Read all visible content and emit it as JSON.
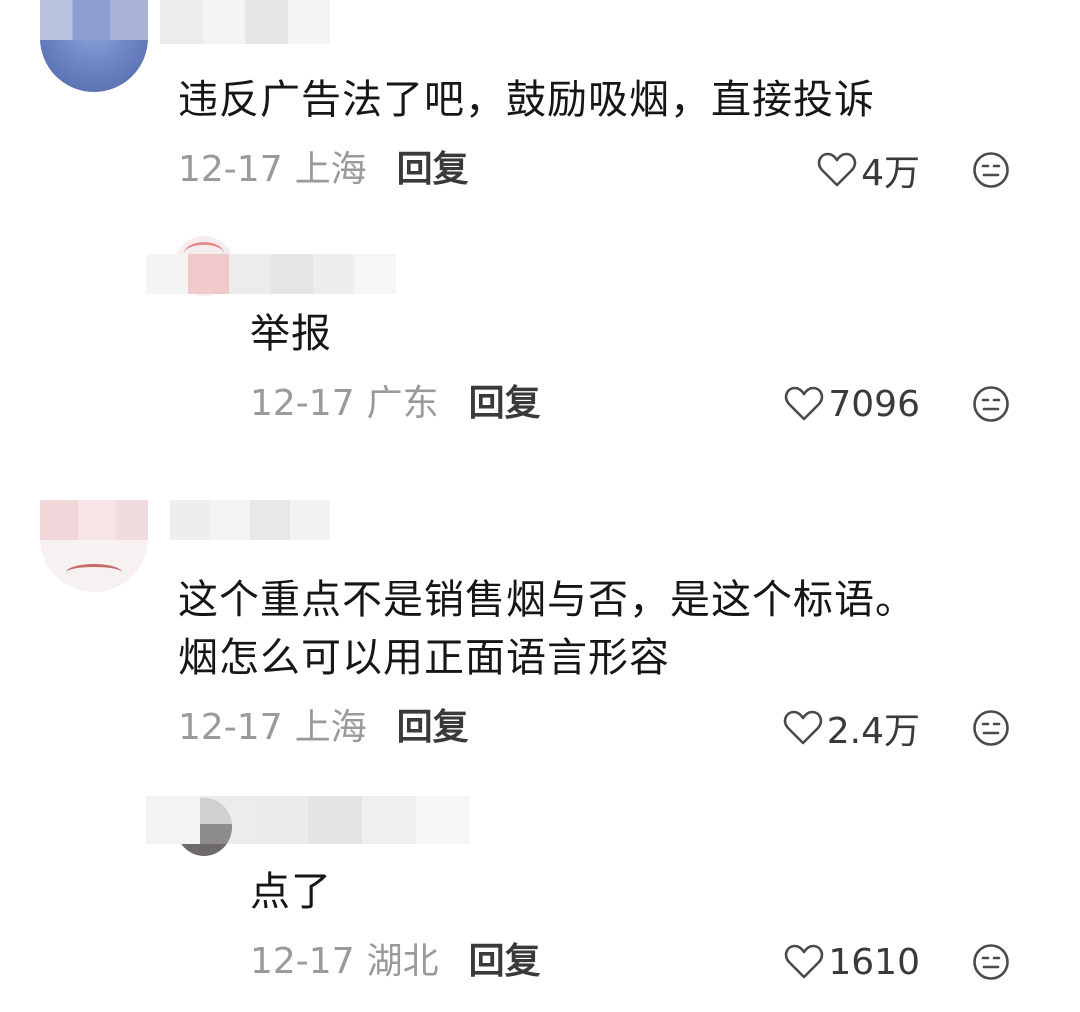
{
  "comments": [
    {
      "text": "违反广告法了吧，鼓励吸烟，直接投诉",
      "date": "12-17",
      "location": "上海",
      "reply_label": "回复",
      "likes": "4万"
    },
    {
      "text": "举报",
      "date": "12-17",
      "location": "广东",
      "reply_label": "回复",
      "likes": "7096"
    },
    {
      "text_lines": [
        "这个重点不是销售烟与否，是这个标语。",
        "烟怎么可以用正面语言形容"
      ],
      "date": "12-17",
      "location": "上海",
      "reply_label": "回复",
      "likes": "2.4万"
    },
    {
      "text": "点了",
      "date": "12-17",
      "location": "湖北",
      "reply_label": "回复",
      "likes": "1610"
    }
  ],
  "icons": {
    "like": "heart-outline-icon",
    "dislike": "neutral-face-icon"
  },
  "colors": {
    "text": "#161616",
    "meta": "#9a9a9a",
    "action": "#3a3a3a"
  }
}
